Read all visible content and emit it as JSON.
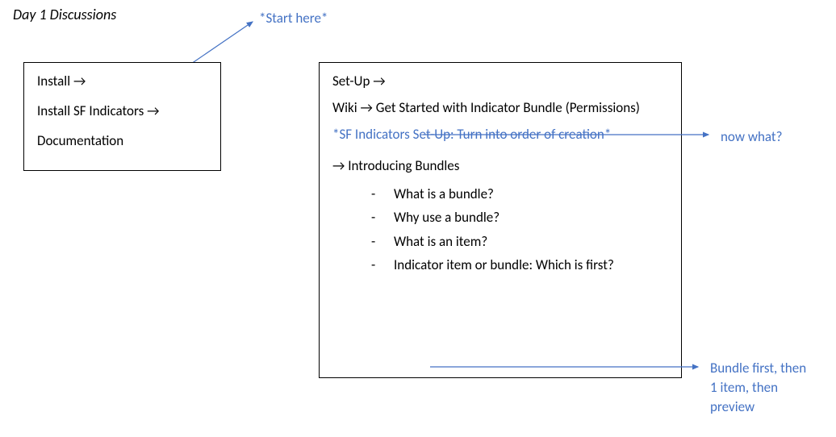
{
  "title": "Day 1 Discussions",
  "leftBox": {
    "line1": "Install",
    "line2": "Install SF Indicators",
    "line3": "Documentation"
  },
  "rightBox": {
    "setup": "Set-Up",
    "wikiPrefix": "Wiki",
    "wikiText": "Get Started with Indicator Bundle (Permissions)",
    "sfNote": "*SF Indicators Set-Up: Turn into order of creation*",
    "introBundles": "Introducing Bundles",
    "bullets": {
      "b1": "What is a bundle?",
      "b2": "Why use a bundle?",
      "b3": "What is an item?",
      "b4": "Indicator item or bundle: Which is first?"
    }
  },
  "annotations": {
    "startHere": "*Start here*",
    "nowWhat": "now what?",
    "bundleFirst": "Bundle first, then 1 item, then preview"
  },
  "glyphs": {
    "arrow": "→"
  }
}
